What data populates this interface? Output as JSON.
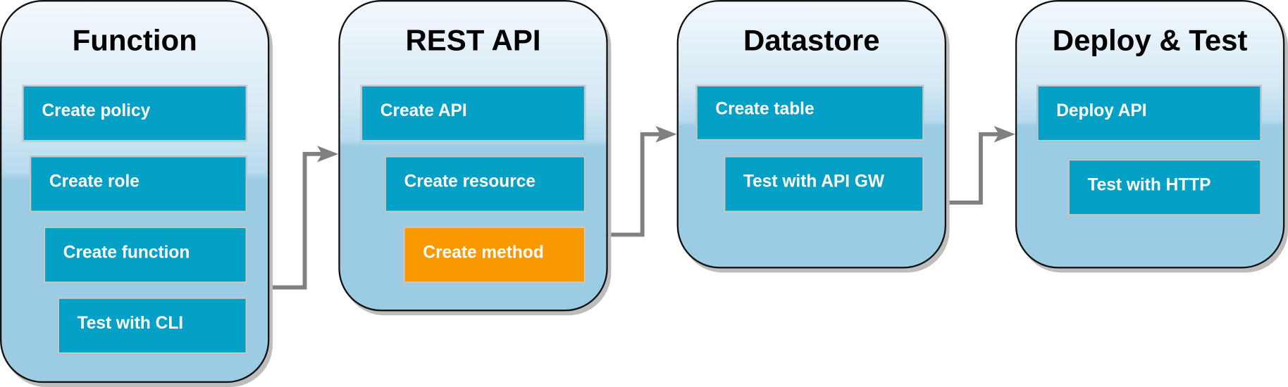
{
  "panels": [
    {
      "title": "Function",
      "steps": [
        "Create policy",
        "Create role",
        "Create function",
        "Test with CLI"
      ]
    },
    {
      "title": "REST API",
      "steps": [
        "Create API",
        "Create resource",
        "Create method"
      ]
    },
    {
      "title": "Datastore",
      "steps": [
        "Create table",
        "Test with API GW"
      ]
    },
    {
      "title": "Deploy & Test",
      "steps": [
        "Deploy API",
        "Test with HTTP"
      ]
    }
  ],
  "active_step": "Create method",
  "colors": {
    "step": "#04a0c6",
    "active_step": "#fa9800",
    "connector": "#808080",
    "panel": "#9ccbe4"
  }
}
